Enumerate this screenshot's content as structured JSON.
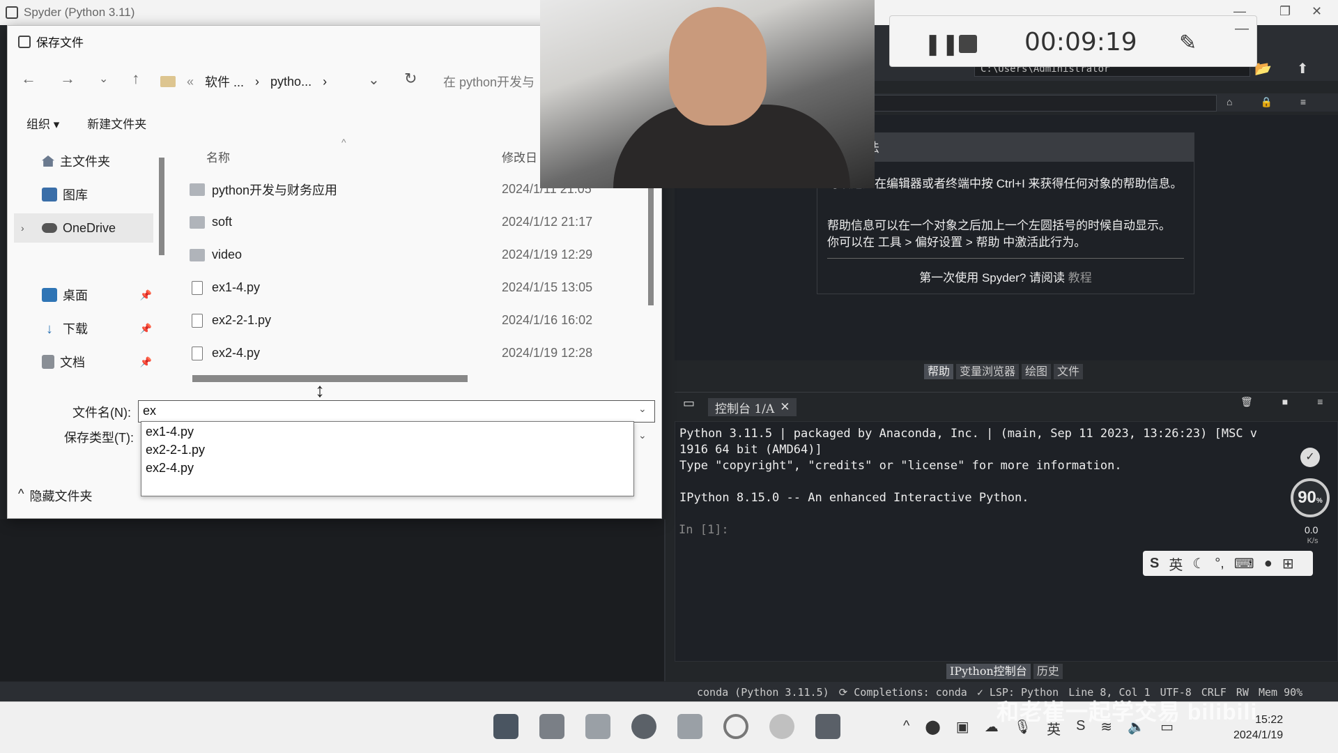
{
  "spyder": {
    "title": "Spyder (Python 3.11)",
    "path": "C:\\Users\\Administrator",
    "help": {
      "heading_fragment": "法",
      "text1": "可以通过在编辑器或者终端中按 Ctrl+I 来获得任何对象的帮助信息。",
      "text2": "帮助信息可以在一个对象之后加上一个左圆括号的时候自动显示。 你可以在 工具 > 偏好设置 > 帮助 中激活此行为。",
      "tutorial": "第一次使用 Spyder? 请阅读",
      "tutorial_link": "教程"
    },
    "pane_tabs": [
      "帮助",
      "变量浏览器",
      "绘图",
      "文件"
    ],
    "console_tab": "控制台 1/A",
    "console_lines": "Python 3.11.5 | packaged by Anaconda, Inc. | (main, Sep 11 2023, 13:26:23) [MSC v\n1916 64 bit (AMD64)]\nType \"copyright\", \"credits\" or \"license\" for more information.\n\nIPython 8.15.0 -- An enhanced Interactive Python.",
    "console_prompt": "In [1]:",
    "console_tabs": [
      "IPython控制台",
      "历史"
    ],
    "status": [
      "conda (Python 3.11.5)",
      "⟳ Completions: conda",
      "✓ LSP: Python",
      "Line 8, Col 1",
      "UTF-8",
      "CRLF",
      "RW",
      "Mem 90%"
    ]
  },
  "dialog": {
    "title": "保存文件",
    "breadcrumb": [
      "软件 ...",
      "pytho..."
    ],
    "search_placeholder": "在 python开发与",
    "toolbar": {
      "organize": "组织 ▾",
      "new_folder": "新建文件夹"
    },
    "sidebar": [
      {
        "label": "主文件夹",
        "icon": "home-icon"
      },
      {
        "label": "图库",
        "icon": "gallery-icon"
      },
      {
        "label": "OneDrive",
        "icon": "cloud-icon"
      },
      {
        "label": "桌面",
        "icon": "desktop-icon"
      },
      {
        "label": "下载",
        "icon": "download-icon"
      },
      {
        "label": "文档",
        "icon": "documents-icon"
      }
    ],
    "columns": {
      "name": "名称",
      "modified": "修改日"
    },
    "files": [
      {
        "name": "python开发与财务应用",
        "date": "2024/1/11 21:05",
        "type": "folder"
      },
      {
        "name": "soft",
        "date": "2024/1/12 21:17",
        "type": "folder"
      },
      {
        "name": "video",
        "date": "2024/1/19 12:29",
        "type": "folder"
      },
      {
        "name": "ex1-4.py",
        "date": "2024/1/15 13:05",
        "type": "file"
      },
      {
        "name": "ex2-2-1.py",
        "date": "2024/1/16 16:02",
        "type": "file"
      },
      {
        "name": "ex2-4.py",
        "date": "2024/1/19 12:28",
        "type": "file"
      }
    ],
    "filename_label": "文件名(N):",
    "filename_value": "ex",
    "filetype_label": "保存类型(T):",
    "autocomplete": [
      "ex1-4.py",
      "ex2-2-1.py",
      "ex2-4.py"
    ],
    "hide_folders": "隐藏文件夹"
  },
  "recorder": {
    "time": "00:09:19"
  },
  "overlay": {
    "perf": "90",
    "perf_unit": "%",
    "net_up": "0.0",
    "net_unit": "K/s",
    "ime_lang": "英"
  },
  "taskbar": {
    "time": "15:22",
    "date": "2024/1/19"
  },
  "watermark": "和老崔一起学交易 bilibili"
}
